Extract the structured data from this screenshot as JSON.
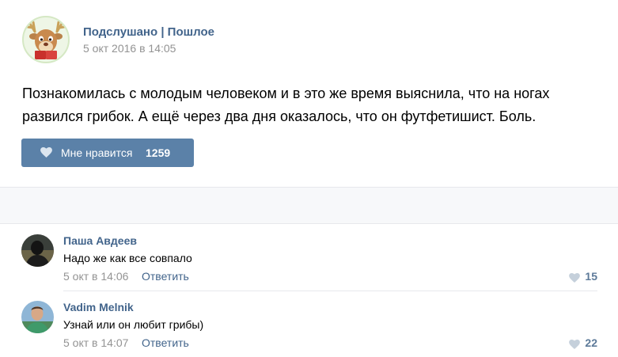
{
  "post": {
    "group_name": "Подслушано | Пошлое",
    "date": "5 окт 2016 в 14:05",
    "text": "Познакомилась с молодым человеком и в это же время выяснила, что на ногах развился грибок. А ещё через два дня оказалось, что он футфетишист. Боль.",
    "like_label": "Мне нравится",
    "like_count": "1259",
    "avatar_icon": "deer-mascot-icon",
    "like_icon": "heart-icon"
  },
  "comments": [
    {
      "author": "Паша Авдеев",
      "text": "Надо же как все совпало",
      "date": "5 окт в 14:06",
      "reply_label": "Ответить",
      "likes": "15"
    },
    {
      "author": "Vadim Melnik",
      "text": "Узнай или он любит грибы)",
      "date": "5 окт в 14:07",
      "reply_label": "Ответить",
      "likes": "22"
    }
  ],
  "colors": {
    "link": "#42648b",
    "button": "#5b81a8",
    "muted": "#939393"
  }
}
